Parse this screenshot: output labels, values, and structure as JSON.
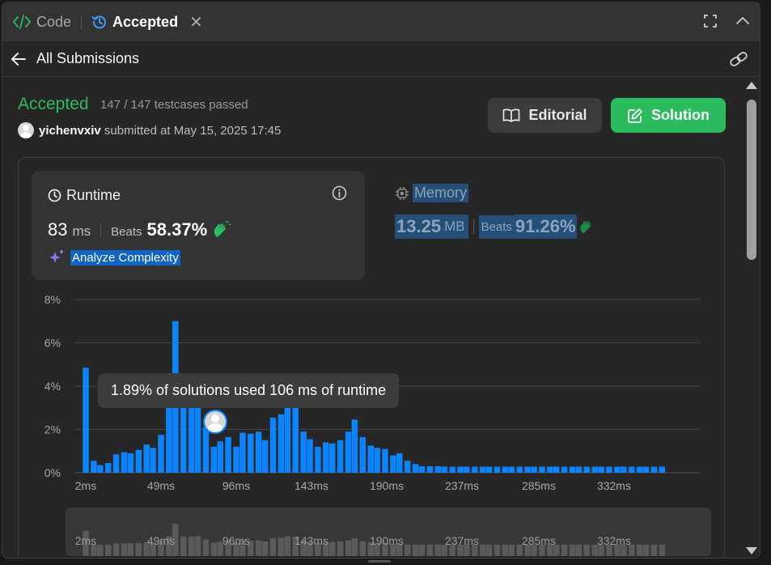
{
  "tabs": {
    "code_label": "Code",
    "accepted_label": "Accepted",
    "close_glyph": "✕"
  },
  "header": {
    "back_label": "All Submissions"
  },
  "submission": {
    "status": "Accepted",
    "testcases": "147 / 147 testcases passed",
    "username": "yichenvxiv",
    "submitted_text": "submitted at May 15, 2025 17:45"
  },
  "buttons": {
    "editorial": "Editorial",
    "solution": "Solution"
  },
  "runtime": {
    "title": "Runtime",
    "value": "83",
    "unit": "ms",
    "beats_label": "Beats",
    "beats_pct": "58.37%",
    "analyze_label": "Analyze Complexity"
  },
  "memory": {
    "title": "Memory",
    "value": "13.25",
    "unit": "MB",
    "beats_label": "Beats",
    "beats_pct": "91.26%"
  },
  "tooltip": {
    "text": "1.89% of solutions used 106 ms of runtime"
  },
  "colors": {
    "accent_green": "#2cbb5d",
    "bar_blue": "#0a84ff",
    "bar_gray": "#5a5a5a",
    "selection": "#0f64c7"
  },
  "chart_data": {
    "type": "bar",
    "ylabel": "",
    "xlabel": "",
    "ylim": [
      0,
      8
    ],
    "yticks": [
      "0%",
      "2%",
      "4%",
      "6%",
      "8%"
    ],
    "xticks": [
      "2ms",
      "49ms",
      "96ms",
      "143ms",
      "190ms",
      "237ms",
      "285ms",
      "332ms"
    ],
    "xtick_values": [
      2,
      49,
      96,
      143,
      190,
      237,
      285,
      332
    ],
    "bar_width_ms": 4.7,
    "x": [
      2,
      7,
      11,
      16,
      21,
      26,
      30,
      35,
      40,
      44,
      49,
      54,
      58,
      63,
      68,
      72,
      77,
      82,
      86,
      91,
      96,
      100,
      105,
      110,
      114,
      119,
      124,
      128,
      133,
      138,
      142,
      147,
      152,
      156,
      161,
      166,
      170,
      175,
      180,
      184,
      189,
      194,
      198,
      203,
      208,
      212,
      217,
      222,
      226,
      231,
      236,
      240,
      245,
      250,
      254,
      259,
      264,
      268,
      273,
      278,
      282,
      287,
      292,
      296,
      301,
      306,
      310,
      315,
      320,
      324,
      329,
      334,
      338,
      343,
      348,
      352,
      357,
      362
    ],
    "values": [
      4.85,
      0.55,
      0.35,
      0.45,
      0.85,
      0.95,
      0.9,
      1.05,
      1.3,
      1.15,
      1.75,
      3.1,
      7.0,
      3.1,
      3.0,
      3.1,
      2.1,
      1.2,
      1.45,
      1.65,
      1.2,
      1.85,
      1.8,
      1.89,
      1.5,
      2.55,
      2.7,
      3.1,
      3.05,
      1.9,
      1.55,
      1.2,
      1.4,
      1.35,
      1.5,
      1.9,
      2.45,
      1.65,
      1.25,
      1.15,
      1.1,
      0.8,
      0.9,
      0.55,
      0.4,
      0.3,
      0.3,
      0.3,
      0.28,
      0.28,
      0.28,
      0.28,
      0.28,
      0.28,
      0.28,
      0.28,
      0.28,
      0.28,
      0.28,
      0.28,
      0.28,
      0.28,
      0.28,
      0.28,
      0.28,
      0.28,
      0.28,
      0.28,
      0.28,
      0.28,
      0.28,
      0.28,
      0.28,
      0.28,
      0.28,
      0.28,
      0.28,
      0.28
    ],
    "highlight_x": 106,
    "highlight_value": 1.89
  }
}
